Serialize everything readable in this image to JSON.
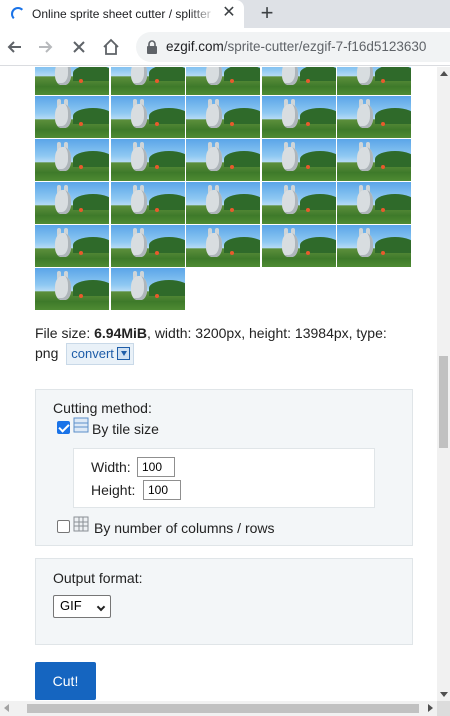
{
  "browser": {
    "tab_title": "Online sprite sheet cutter / splitter",
    "tab_close_glyph": "✕",
    "new_tab_glyph": "+",
    "url_host": "ezgif.com",
    "url_path": "/sprite-cutter/ezgif-7-f16d5123630",
    "icons": [
      "loading-spinner-icon",
      "close-icon",
      "plus-icon",
      "back-arrow-icon",
      "forward-arrow-icon",
      "stop-icon",
      "home-icon",
      "lock-icon"
    ]
  },
  "sprite_grid": {
    "columns": 5,
    "full_rows": 5,
    "last_row_tiles": 2,
    "description_icon": "sprite-thumbnail"
  },
  "file_info": {
    "size_label": "File size: ",
    "size_value": "6.94MiB",
    "rest": ", width: 3200px, height: 13984px, type: png",
    "convert_label": "convert"
  },
  "cutting": {
    "heading": "Cutting method:",
    "tile_size_label": "By tile size",
    "tile_size_checked": true,
    "width_label": "Width:",
    "width_value": "100",
    "height_label": "Height:",
    "height_value": "100",
    "columns_rows_label": "By number of columns / rows",
    "columns_rows_checked": false
  },
  "output": {
    "heading": "Output format:",
    "selected": "GIF"
  },
  "cut_button": "Cut!",
  "colors": {
    "accent": "#1565c0",
    "panel_bg": "#f3f6f8",
    "link": "#1d5ca8"
  }
}
